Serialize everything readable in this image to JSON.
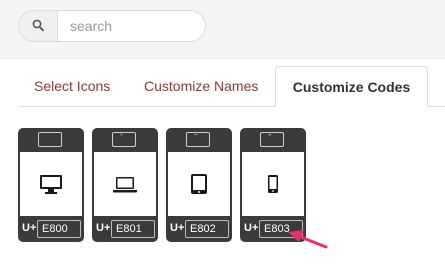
{
  "search": {
    "placeholder": "search",
    "icon": "search-icon"
  },
  "tabs": [
    {
      "label": "Select Icons",
      "active": false
    },
    {
      "label": "Customize Names",
      "active": false
    },
    {
      "label": "Customize Codes",
      "active": true
    }
  ],
  "cards": [
    {
      "glyph": "",
      "icon": "desktop-icon",
      "prefix": "U+",
      "code": "E800"
    },
    {
      "glyph": "̀",
      "icon": "laptop-icon",
      "prefix": "U+",
      "code": "E801"
    },
    {
      "glyph": "͂",
      "icon": "tablet-icon",
      "prefix": "U+",
      "code": "E802"
    },
    {
      "glyph": "̂",
      "icon": "mobile-icon",
      "prefix": "U+",
      "code": "E803"
    }
  ],
  "colors": {
    "accent": "#8b3a3a",
    "card_bg": "#3b3b3b",
    "arrow": "#e8306b"
  }
}
